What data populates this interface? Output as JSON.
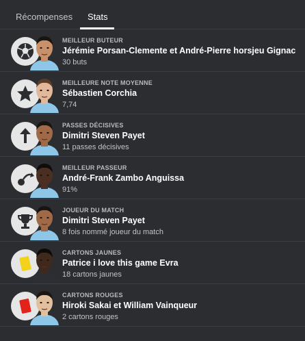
{
  "tabs": [
    {
      "label": "Récompenses"
    },
    {
      "label": "Stats"
    }
  ],
  "awards": [
    {
      "category": "MEILLEUR BUTEUR",
      "player": "Jérémie Porsan-Clemente et André-Pierre horsjeu Gignac",
      "value": "30 buts",
      "icon": "football-icon",
      "skin": "#c8916a",
      "hair": "#1a1410",
      "shirt": "#8ec6e8"
    },
    {
      "category": "MEILLEURE NOTE MOYENNE",
      "player": "Sébastien Corchia",
      "value": "7,74",
      "icon": "star-icon",
      "skin": "#e2b89a",
      "hair": "#5b3d27",
      "shirt": "#8ec6e8"
    },
    {
      "category": "PASSES DÉCISIVES",
      "player": "Dimitri Steven Payet",
      "value": "11 passes décisives",
      "icon": "assist-arrow-icon",
      "skin": "#a06a48",
      "hair": "#1a1410",
      "shirt": "#8ec6e8"
    },
    {
      "category": "MEILLEUR PASSEUR",
      "player": "André-Frank Zambo Anguissa",
      "value": "91%",
      "icon": "pass-icon",
      "skin": "#4a2f22",
      "hair": "#120c08",
      "shirt": "#8ec6e8"
    },
    {
      "category": "JOUEUR DU MATCH",
      "player": "Dimitri Steven Payet",
      "value": "8 fois nommé joueur du match",
      "icon": "trophy-icon",
      "skin": "#a06a48",
      "hair": "#1a1410",
      "shirt": "#8ec6e8"
    },
    {
      "category": "CARTONS JAUNES",
      "player": "Patrice i love this game Evra",
      "value": "18 cartons jaunes",
      "icon": "yellow-card-icon",
      "skin": "#3f291d",
      "hair": "#100a06",
      "shirt": "#2c2e33"
    },
    {
      "category": "CARTONS ROUGES",
      "player": "Hiroki Sakai et William Vainqueur",
      "value": "2 cartons rouges",
      "icon": "red-card-icon",
      "skin": "#e2c09e",
      "hair": "#1b1612",
      "shirt": "#8ec6e8"
    }
  ],
  "colors": {
    "background": "#2b2d31",
    "divider": "#3b3e44",
    "badge": "#e6e6e6",
    "icon": "#2b2d31",
    "yellow_card": "#f3d21b",
    "red_card": "#e2231a"
  }
}
